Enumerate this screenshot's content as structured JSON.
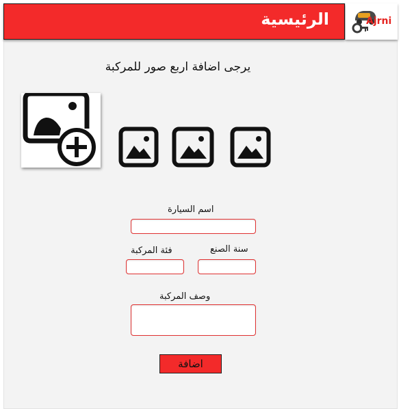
{
  "header": {
    "title": "الرئيسية",
    "brand": "Ajrni",
    "brand_color": "#e52420",
    "bar_color": "#f32a2a"
  },
  "main": {
    "instruction": "يرجى اضافة اربع صور للمركبة",
    "add_photo_icon": "add-photo-icon",
    "image_slots": [
      {
        "icon": "image-placeholder-icon"
      },
      {
        "icon": "image-placeholder-icon"
      },
      {
        "icon": "image-placeholder-icon"
      }
    ]
  },
  "form": {
    "car_name_label": "اسم السيارة",
    "car_name_value": "",
    "manufacture_year_label": "سنة الصنع",
    "manufacture_year_value": "",
    "vehicle_category_label": "فئة المركبة",
    "vehicle_category_value": "",
    "vehicle_description_label": "وصف المركبة",
    "vehicle_description_value": "",
    "submit_label": "اضافة",
    "field_border_color": "#e03030"
  }
}
